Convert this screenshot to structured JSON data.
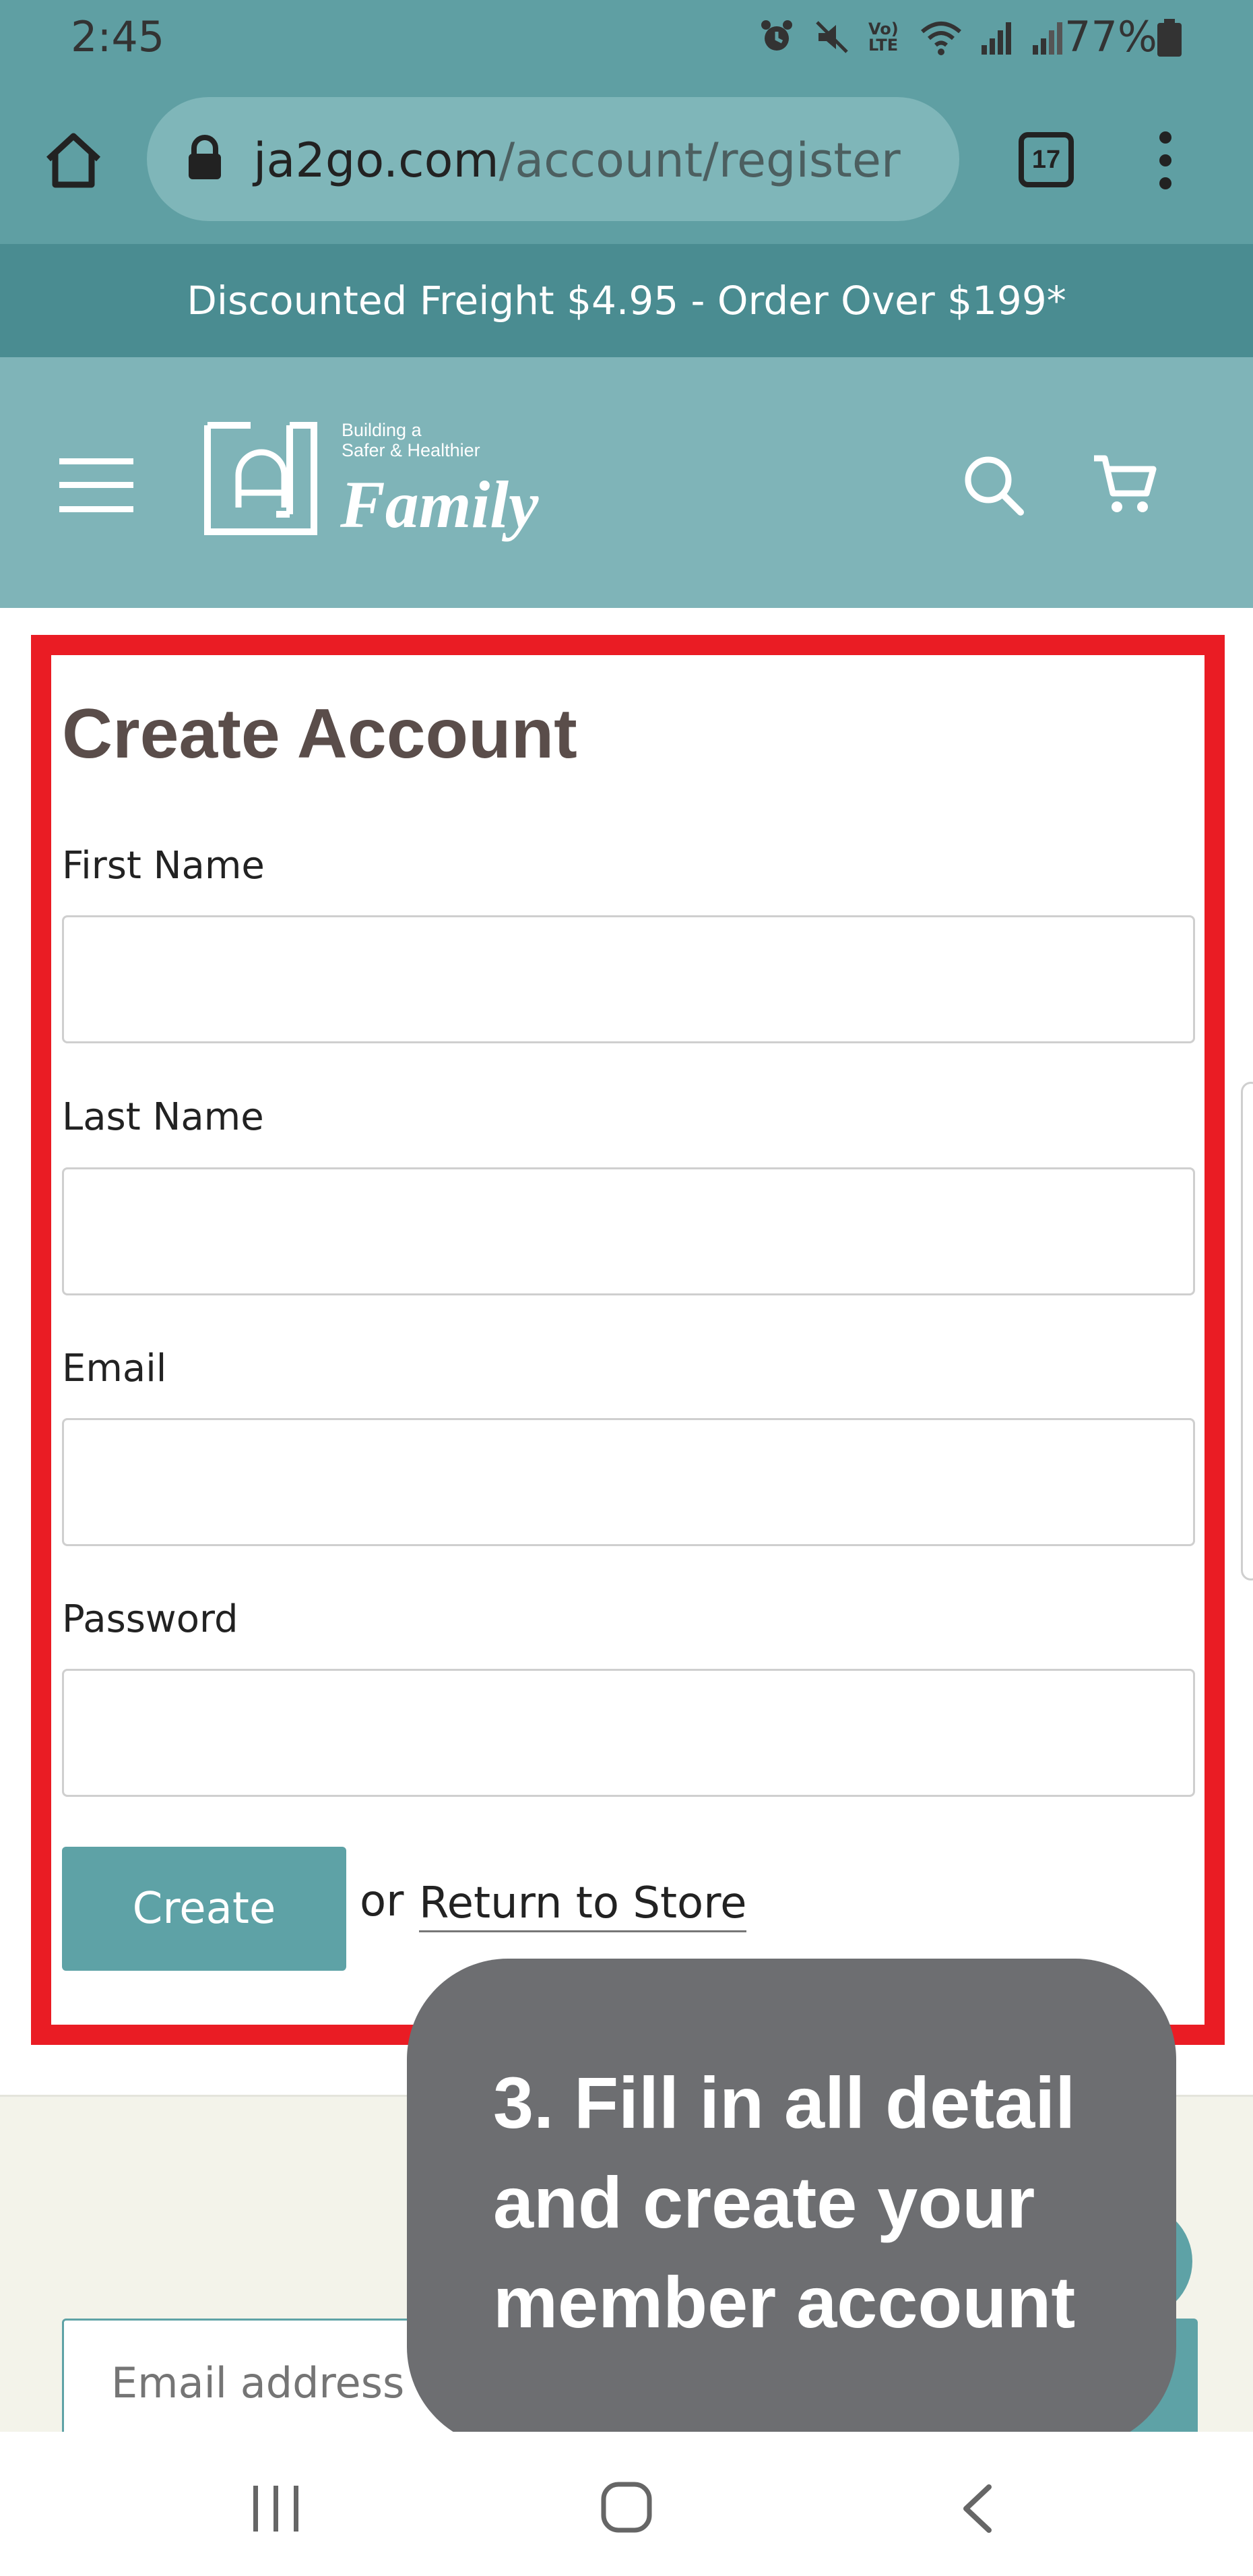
{
  "status_bar": {
    "time": "2:45",
    "network_label": "Vo) LTE",
    "battery_percent": "77%"
  },
  "browser": {
    "url_domain": "ja2go.com",
    "url_path": "/account/register",
    "tab_count": "17"
  },
  "announcement": "Discounted Freight $4.95 - Order Over $199*",
  "header": {
    "logo_tagline_1": "Building a",
    "logo_tagline_2": "Safer & Healthier",
    "logo_word": "Family"
  },
  "form": {
    "title": "Create Account",
    "fields": [
      {
        "label": "First Name",
        "value": ""
      },
      {
        "label": "Last Name",
        "value": ""
      },
      {
        "label": "Email",
        "value": ""
      },
      {
        "label": "Password",
        "value": ""
      }
    ],
    "create_label": "Create",
    "or_text": "or",
    "return_label": "Return to Store"
  },
  "footer": {
    "newsletter_placeholder": "Email address"
  },
  "instruction": "3. Fill in all detail\nand create your\nmember account",
  "colors": {
    "teal_dark": "#4a8c91",
    "teal": "#5f9fa3",
    "teal_light": "#7fb4b8",
    "highlight_red": "#ea1c24",
    "overlay_grey": "#6d6e71"
  }
}
